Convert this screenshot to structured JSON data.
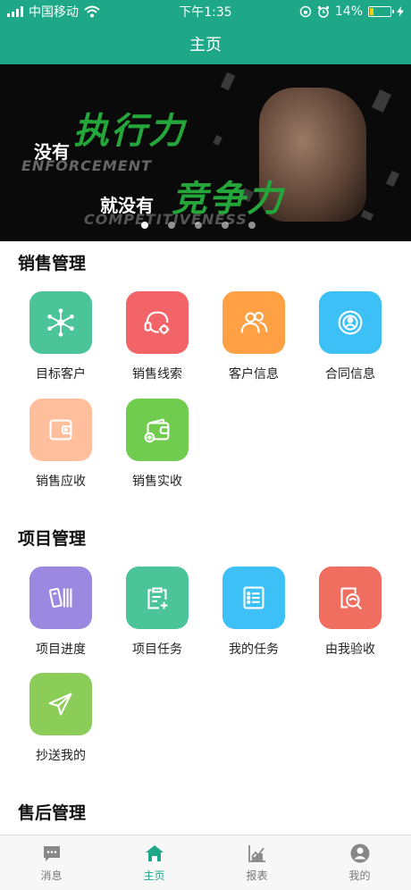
{
  "status_bar": {
    "carrier": "中国移动",
    "time": "下午1:35",
    "battery": "14%"
  },
  "nav": {
    "title": "主页"
  },
  "banner": {
    "line1_prefix": "没有",
    "line1_main": "执行力",
    "line1_sub": "ENFORCEMENT",
    "line2_prefix": "就没有",
    "line2_main": "竞争力",
    "line2_sub": "COMPETITIVENESS",
    "slides": 5,
    "active_slide": 1
  },
  "sections": [
    {
      "title": "销售管理",
      "items": [
        {
          "label": "目标客户",
          "icon": "network-icon",
          "color": "#4cc49a"
        },
        {
          "label": "销售线索",
          "icon": "headset-icon",
          "color": "#f26468"
        },
        {
          "label": "客户信息",
          "icon": "users-icon",
          "color": "#ffa044"
        },
        {
          "label": "合同信息",
          "icon": "contract-icon",
          "color": "#3cc0f5"
        },
        {
          "label": "销售应收",
          "icon": "wallet-icon",
          "color": "#ffbf9c"
        },
        {
          "label": "销售实收",
          "icon": "wallet-add-icon",
          "color": "#6fcc4e"
        }
      ]
    },
    {
      "title": "项目管理",
      "items": [
        {
          "label": "项目进度",
          "icon": "progress-icon",
          "color": "#9b88e0"
        },
        {
          "label": "项目任务",
          "icon": "clipboard-icon",
          "color": "#4cc49a"
        },
        {
          "label": "我的任务",
          "icon": "list-icon",
          "color": "#3cc0f5"
        },
        {
          "label": "由我验收",
          "icon": "inspect-icon",
          "color": "#f06e60"
        },
        {
          "label": "抄送我的",
          "icon": "send-icon",
          "color": "#8ccc58"
        }
      ]
    },
    {
      "title": "售后管理",
      "items": []
    }
  ],
  "tabs": [
    {
      "label": "消息",
      "icon": "message-icon",
      "active": false
    },
    {
      "label": "主页",
      "icon": "home-icon",
      "active": true
    },
    {
      "label": "报表",
      "icon": "report-icon",
      "active": false
    },
    {
      "label": "我的",
      "icon": "profile-icon",
      "active": false
    }
  ],
  "colors": {
    "primary": "#1fa888",
    "tab_inactive": "#777777"
  }
}
